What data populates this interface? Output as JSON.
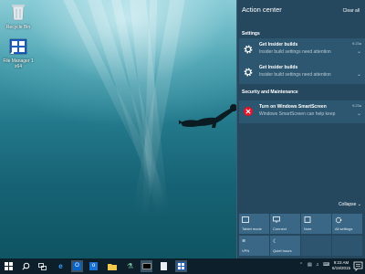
{
  "desktop": {
    "icons": [
      {
        "name": "recycle-bin",
        "label": "Recycle Bin"
      },
      {
        "name": "file-manager",
        "label": "File Manager 1 x64"
      }
    ]
  },
  "action_center": {
    "title": "Action center",
    "clear_all": "Clear all",
    "sections": [
      {
        "title": "Settings",
        "notifications": [
          {
            "icon": "gear-icon",
            "title": "Get Insider builds",
            "body": "Insider build settings need attention",
            "time": "9:23a"
          },
          {
            "icon": "gear-icon",
            "title": "Get Insider builds",
            "body": "Insider build settings need attention",
            "time": ""
          }
        ]
      },
      {
        "title": "Security and Maintenance",
        "notifications": [
          {
            "icon": "error-icon",
            "title": "Turn on Windows SmartScreen",
            "body": "Windows SmartScreen can help keep",
            "time": "9:23a"
          }
        ]
      }
    ],
    "collapse": "Collapse",
    "quick_actions": [
      {
        "label": "Tablet mode",
        "icon": "tablet-icon"
      },
      {
        "label": "Connect",
        "icon": "connect-icon"
      },
      {
        "label": "Note",
        "icon": "note-icon"
      },
      {
        "label": "All settings",
        "icon": "settings-icon"
      },
      {
        "label": "VPN",
        "icon": "vpn-icon"
      },
      {
        "label": "Quiet hours",
        "icon": "moon-icon"
      },
      {
        "label": "",
        "icon": ""
      },
      {
        "label": "",
        "icon": ""
      }
    ]
  },
  "taskbar": {
    "clock_time": "9:23 AM",
    "clock_date": "6/19/2015"
  }
}
